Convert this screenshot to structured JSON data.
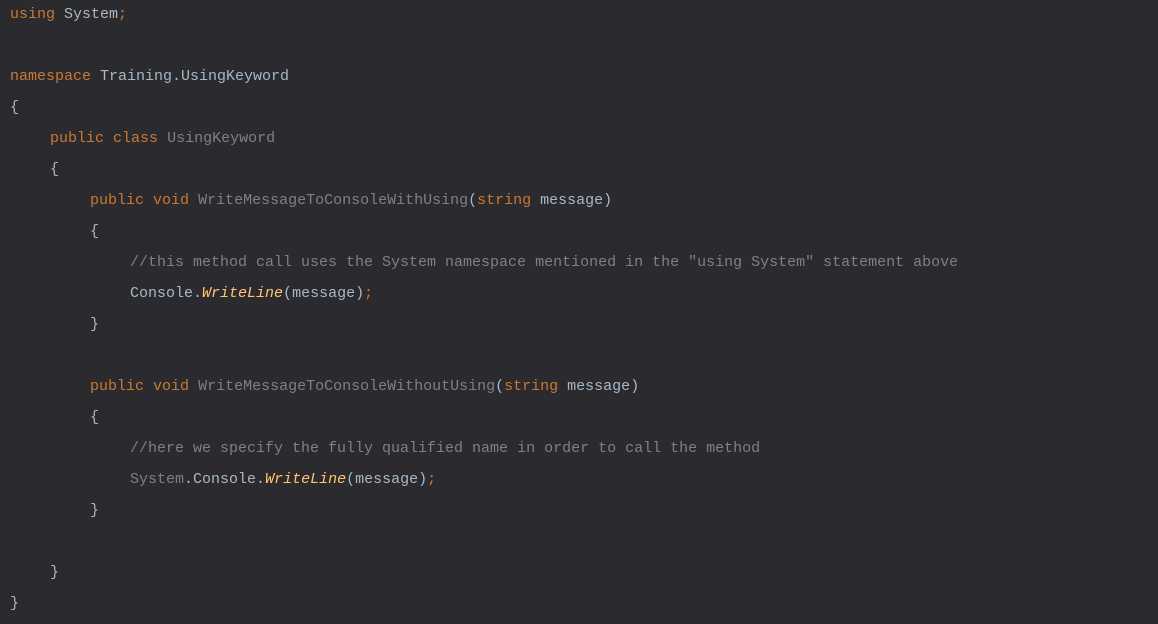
{
  "code": {
    "line1": {
      "using": "using",
      "system": "System",
      "semi": ";"
    },
    "line3": {
      "namespace": "namespace",
      "name": "Training.UsingKeyword"
    },
    "line4": {
      "brace": "{"
    },
    "line5": {
      "public": "public",
      "class": "class",
      "name": "UsingKeyword"
    },
    "line6": {
      "brace": "{"
    },
    "line7": {
      "public": "public",
      "void": "void",
      "method": "WriteMessageToConsoleWithUsing",
      "open": "(",
      "string": "string",
      "param": "message",
      "close": ")"
    },
    "line8": {
      "brace": "{"
    },
    "line9": {
      "comment": "//this method call uses the System namespace mentioned in the \"using System\" statement above"
    },
    "line10": {
      "console": "Console",
      "dot": ".",
      "writeline": "WriteLine",
      "open": "(",
      "param": "message",
      "close": ")",
      "semi": ";"
    },
    "line11": {
      "brace": "}"
    },
    "line13": {
      "public": "public",
      "void": "void",
      "method": "WriteMessageToConsoleWithoutUsing",
      "open": "(",
      "string": "string",
      "param": "message",
      "close": ")"
    },
    "line14": {
      "brace": "{"
    },
    "line15": {
      "comment": "//here we specify the fully qualified name in order to call the method"
    },
    "line16": {
      "system": "System",
      "dot1": ".",
      "console": "Console",
      "dot2": ".",
      "writeline": "WriteLine",
      "open": "(",
      "param": "message",
      "close": ")",
      "semi": ";"
    },
    "line17": {
      "brace": "}"
    },
    "line19": {
      "brace": "}"
    },
    "line20": {
      "brace": "}"
    }
  }
}
